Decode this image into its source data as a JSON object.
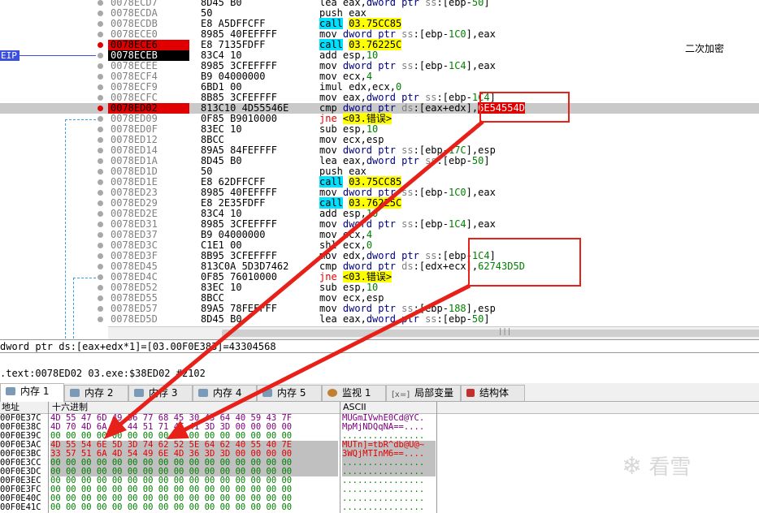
{
  "eip_label": "EIP",
  "comment_text": "二次加密",
  "disasm_rows": [
    {
      "addr": "0078ECD7",
      "bytes": "8D45 B0",
      "asm": [
        [
          "mnem",
          "lea "
        ],
        [
          "reg",
          "eax"
        ],
        [
          "t",
          ","
        ],
        [
          "k",
          "dword ptr "
        ],
        [
          "seg",
          "ss"
        ],
        [
          "t",
          ":["
        ],
        [
          "reg",
          "ebp"
        ],
        [
          "t",
          "-"
        ],
        [
          "num",
          "50"
        ],
        [
          "t",
          "]"
        ]
      ],
      "bp": "gray",
      "style": ""
    },
    {
      "addr": "0078ECDA",
      "bytes": "50",
      "asm": [
        [
          "mnem",
          "push "
        ],
        [
          "reg",
          "eax"
        ]
      ],
      "bp": "gray",
      "style": ""
    },
    {
      "addr": "0078ECDB",
      "bytes": "E8 A5DFFCFF",
      "asm": [
        [
          "cyan",
          "call"
        ],
        [
          "t",
          " "
        ],
        [
          "yel",
          "03.75CC85"
        ]
      ],
      "bp": "gray",
      "style": ""
    },
    {
      "addr": "0078ECE0",
      "bytes": "8985 40FEFFFF",
      "asm": [
        [
          "mnem",
          "mov "
        ],
        [
          "k",
          "dword ptr "
        ],
        [
          "seg",
          "ss"
        ],
        [
          "t",
          ":["
        ],
        [
          "reg",
          "ebp"
        ],
        [
          "t",
          "-"
        ],
        [
          "num",
          "1C0"
        ],
        [
          "t",
          "],"
        ],
        [
          "reg",
          "eax"
        ]
      ],
      "bp": "gray",
      "style": ""
    },
    {
      "addr": "0078ECE6",
      "bytes": "E8 7135FDFF",
      "asm": [
        [
          "cyan",
          "call"
        ],
        [
          "t",
          " "
        ],
        [
          "yel",
          "03.76225C"
        ]
      ],
      "bp": "red",
      "style": "redbg"
    },
    {
      "addr": "0078ECEB",
      "bytes": "83C4 10",
      "asm": [
        [
          "mnem",
          "add "
        ],
        [
          "reg",
          "esp"
        ],
        [
          "t",
          ","
        ],
        [
          "num",
          "10"
        ]
      ],
      "bp": "gray",
      "style": "blackbg"
    },
    {
      "addr": "0078ECEE",
      "bytes": "8985 3CFEFFFF",
      "asm": [
        [
          "mnem",
          "mov "
        ],
        [
          "k",
          "dword ptr "
        ],
        [
          "seg",
          "ss"
        ],
        [
          "t",
          ":["
        ],
        [
          "reg",
          "ebp"
        ],
        [
          "t",
          "-"
        ],
        [
          "num",
          "1C4"
        ],
        [
          "t",
          "],"
        ],
        [
          "reg",
          "eax"
        ]
      ],
      "bp": "gray",
      "style": ""
    },
    {
      "addr": "0078ECF4",
      "bytes": "B9 04000000",
      "asm": [
        [
          "mnem",
          "mov "
        ],
        [
          "reg",
          "ecx"
        ],
        [
          "t",
          ","
        ],
        [
          "num",
          "4"
        ]
      ],
      "bp": "gray",
      "style": ""
    },
    {
      "addr": "0078ECF9",
      "bytes": "6BD1 00",
      "asm": [
        [
          "mnem",
          "imul "
        ],
        [
          "reg",
          "edx"
        ],
        [
          "t",
          ","
        ],
        [
          "reg",
          "ecx"
        ],
        [
          "t",
          ","
        ],
        [
          "num",
          "0"
        ]
      ],
      "bp": "gray",
      "style": ""
    },
    {
      "addr": "0078ECFC",
      "bytes": "8B85 3CFEFFFF",
      "asm": [
        [
          "mnem",
          "mov "
        ],
        [
          "reg",
          "eax"
        ],
        [
          "t",
          ","
        ],
        [
          "k",
          "dword ptr "
        ],
        [
          "seg",
          "ss"
        ],
        [
          "t",
          ":["
        ],
        [
          "reg",
          "ebp"
        ],
        [
          "t",
          "-"
        ],
        [
          "num",
          "1C4"
        ],
        [
          "t",
          "]"
        ]
      ],
      "bp": "gray",
      "style": ""
    },
    {
      "addr": "0078ED02",
      "bytes": "813C10 4D55546E",
      "asm": [
        [
          "mnem",
          "cmp "
        ],
        [
          "k",
          "dword ptr "
        ],
        [
          "seg",
          "ds"
        ],
        [
          "t",
          ":["
        ],
        [
          "reg",
          "eax"
        ],
        [
          "t",
          "+"
        ],
        [
          "reg",
          "edx"
        ],
        [
          "t",
          "],"
        ],
        [
          "redbox",
          "6E54554D"
        ]
      ],
      "bp": "red",
      "style": "redbg",
      "sel": true
    },
    {
      "addr": "0078ED09",
      "bytes": "0F85 B9010000",
      "asm": [
        [
          "red",
          "jne"
        ],
        [
          "t",
          " "
        ],
        [
          "yel",
          "<03.错误>"
        ]
      ],
      "bp": "gray",
      "style": ""
    },
    {
      "addr": "0078ED0F",
      "bytes": "83EC 10",
      "asm": [
        [
          "mnem",
          "sub "
        ],
        [
          "reg",
          "esp"
        ],
        [
          "t",
          ","
        ],
        [
          "num",
          "10"
        ]
      ],
      "bp": "gray",
      "style": ""
    },
    {
      "addr": "0078ED12",
      "bytes": "8BCC",
      "asm": [
        [
          "mnem",
          "mov "
        ],
        [
          "reg",
          "ecx"
        ],
        [
          "t",
          ","
        ],
        [
          "reg",
          "esp"
        ]
      ],
      "bp": "gray",
      "style": ""
    },
    {
      "addr": "0078ED14",
      "bytes": "89A5 84FEFFFF",
      "asm": [
        [
          "mnem",
          "mov "
        ],
        [
          "k",
          "dword ptr "
        ],
        [
          "seg",
          "ss"
        ],
        [
          "t",
          ":["
        ],
        [
          "reg",
          "ebp"
        ],
        [
          "t",
          "-"
        ],
        [
          "num",
          "17C"
        ],
        [
          "t",
          "],"
        ],
        [
          "reg",
          "esp"
        ]
      ],
      "bp": "gray",
      "style": ""
    },
    {
      "addr": "0078ED1A",
      "bytes": "8D45 B0",
      "asm": [
        [
          "mnem",
          "lea "
        ],
        [
          "reg",
          "eax"
        ],
        [
          "t",
          ","
        ],
        [
          "k",
          "dword ptr "
        ],
        [
          "seg",
          "ss"
        ],
        [
          "t",
          ":["
        ],
        [
          "reg",
          "ebp"
        ],
        [
          "t",
          "-"
        ],
        [
          "num",
          "50"
        ],
        [
          "t",
          "]"
        ]
      ],
      "bp": "gray",
      "style": ""
    },
    {
      "addr": "0078ED1D",
      "bytes": "50",
      "asm": [
        [
          "mnem",
          "push "
        ],
        [
          "reg",
          "eax"
        ]
      ],
      "bp": "gray",
      "style": ""
    },
    {
      "addr": "0078ED1E",
      "bytes": "E8 62DFFCFF",
      "asm": [
        [
          "cyan",
          "call"
        ],
        [
          "t",
          " "
        ],
        [
          "yel",
          "03.75CC85"
        ]
      ],
      "bp": "gray",
      "style": ""
    },
    {
      "addr": "0078ED23",
      "bytes": "8985 40FEFFFF",
      "asm": [
        [
          "mnem",
          "mov "
        ],
        [
          "k",
          "dword ptr "
        ],
        [
          "seg",
          "ss"
        ],
        [
          "t",
          ":["
        ],
        [
          "reg",
          "ebp"
        ],
        [
          "t",
          "-"
        ],
        [
          "num",
          "1C0"
        ],
        [
          "t",
          "],"
        ],
        [
          "reg",
          "eax"
        ]
      ],
      "bp": "gray",
      "style": ""
    },
    {
      "addr": "0078ED29",
      "bytes": "E8 2E35FDFF",
      "asm": [
        [
          "cyan",
          "call"
        ],
        [
          "t",
          " "
        ],
        [
          "yel",
          "03.76225C"
        ]
      ],
      "bp": "gray",
      "style": ""
    },
    {
      "addr": "0078ED2E",
      "bytes": "83C4 10",
      "asm": [
        [
          "mnem",
          "add "
        ],
        [
          "reg",
          "esp"
        ],
        [
          "t",
          ","
        ],
        [
          "num",
          "10"
        ]
      ],
      "bp": "gray",
      "style": ""
    },
    {
      "addr": "0078ED31",
      "bytes": "8985 3CFEFFFF",
      "asm": [
        [
          "mnem",
          "mov "
        ],
        [
          "k",
          "dword ptr "
        ],
        [
          "seg",
          "ss"
        ],
        [
          "t",
          ":["
        ],
        [
          "reg",
          "ebp"
        ],
        [
          "t",
          "-"
        ],
        [
          "num",
          "1C4"
        ],
        [
          "t",
          "],"
        ],
        [
          "reg",
          "eax"
        ]
      ],
      "bp": "gray",
      "style": ""
    },
    {
      "addr": "0078ED37",
      "bytes": "B9 04000000",
      "asm": [
        [
          "mnem",
          "mov "
        ],
        [
          "reg",
          "ecx"
        ],
        [
          "t",
          ","
        ],
        [
          "num",
          "4"
        ]
      ],
      "bp": "gray",
      "style": ""
    },
    {
      "addr": "0078ED3C",
      "bytes": "C1E1 00",
      "asm": [
        [
          "mnem",
          "shl "
        ],
        [
          "reg",
          "ecx"
        ],
        [
          "t",
          ","
        ],
        [
          "num",
          "0"
        ]
      ],
      "bp": "gray",
      "style": ""
    },
    {
      "addr": "0078ED3F",
      "bytes": "8B95 3CFEFFFF",
      "asm": [
        [
          "mnem",
          "mov "
        ],
        [
          "reg",
          "edx"
        ],
        [
          "t",
          ","
        ],
        [
          "k",
          "dword ptr "
        ],
        [
          "seg",
          "ss"
        ],
        [
          "t",
          ":["
        ],
        [
          "reg",
          "ebp"
        ],
        [
          "t",
          "-"
        ],
        [
          "num",
          "1C4"
        ],
        [
          "t",
          "]"
        ]
      ],
      "bp": "gray",
      "style": ""
    },
    {
      "addr": "0078ED45",
      "bytes": "813C0A 5D3D7462",
      "asm": [
        [
          "mnem",
          "cmp "
        ],
        [
          "k",
          "dword ptr "
        ],
        [
          "seg",
          "ds"
        ],
        [
          "t",
          ":["
        ],
        [
          "reg",
          "edx"
        ],
        [
          "t",
          "+"
        ],
        [
          "reg",
          "ecx"
        ],
        [
          "t",
          "],"
        ],
        [
          "num",
          "62743D5D"
        ]
      ],
      "bp": "gray",
      "style": ""
    },
    {
      "addr": "0078ED4C",
      "bytes": "0F85 76010000",
      "asm": [
        [
          "red",
          "jne"
        ],
        [
          "t",
          " "
        ],
        [
          "yel",
          "<03.错误>"
        ]
      ],
      "bp": "gray",
      "style": ""
    },
    {
      "addr": "0078ED52",
      "bytes": "83EC 10",
      "asm": [
        [
          "mnem",
          "sub "
        ],
        [
          "reg",
          "esp"
        ],
        [
          "t",
          ","
        ],
        [
          "num",
          "10"
        ]
      ],
      "bp": "gray",
      "style": ""
    },
    {
      "addr": "0078ED55",
      "bytes": "8BCC",
      "asm": [
        [
          "mnem",
          "mov "
        ],
        [
          "reg",
          "ecx"
        ],
        [
          "t",
          ","
        ],
        [
          "reg",
          "esp"
        ]
      ],
      "bp": "gray",
      "style": ""
    },
    {
      "addr": "0078ED57",
      "bytes": "89A5 78FEFFFF",
      "asm": [
        [
          "mnem",
          "mov "
        ],
        [
          "k",
          "dword ptr "
        ],
        [
          "seg",
          "ss"
        ],
        [
          "t",
          ":["
        ],
        [
          "reg",
          "ebp"
        ],
        [
          "t",
          "-"
        ],
        [
          "num",
          "188"
        ],
        [
          "t",
          "],"
        ],
        [
          "reg",
          "esp"
        ]
      ],
      "bp": "gray",
      "style": ""
    },
    {
      "addr": "0078ED5D",
      "bytes": "8D45 B0",
      "asm": [
        [
          "mnem",
          "lea "
        ],
        [
          "reg",
          "eax"
        ],
        [
          "t",
          ","
        ],
        [
          "k",
          "dword ptr "
        ],
        [
          "seg",
          "ss"
        ],
        [
          "t",
          ":["
        ],
        [
          "reg",
          "ebp"
        ],
        [
          "t",
          "-"
        ],
        [
          "num",
          "50"
        ],
        [
          "t",
          "]"
        ]
      ],
      "bp": "gray",
      "style": ""
    }
  ],
  "info_line": "dword ptr ds:[eax+edx*1]=[03.00F0E383]=43304568",
  "status_line": ".text:0078ED02 03.exe:$38ED02 #2102",
  "tabs": [
    "内存 1",
    "内存 2",
    "内存 3",
    "内存 4",
    "内存 5",
    "监视 1",
    "局部变量",
    "结构体"
  ],
  "mem_header": {
    "addr": "地址",
    "hex": "十六进制",
    "ascii": "ASCII"
  },
  "mem_rows": [
    {
      "addr": "00F0E37C",
      "hex": "4D 55 47 6D 49 56 77 68 45 30 43 64 40 59 43 7F",
      "ascii": "MUGmIVwhE0Cd@YC.",
      "style": "purple"
    },
    {
      "addr": "00F0E38C",
      "hex": "4D 70 4D 6A 4E 44 51 71 4E 41 3D 3D 00 00 00 00",
      "ascii": "MpMjNDQqNA==....",
      "style": "purple"
    },
    {
      "addr": "00F0E39C",
      "hex": "00 00 00 00 00 00 00 00 00 00 00 00 00 00 00 00",
      "ascii": "................",
      "style": ""
    },
    {
      "addr": "00F0E3AC",
      "hex": "4D 55 54 6E 5D 3D 74 62 52 5E 64 62 40 55 40 7E",
      "ascii": "MUTn]=tbR^db@U@~",
      "style": "hl"
    },
    {
      "addr": "00F0E3BC",
      "hex": "33 57 51 6A 4D 54 49 6E 4D 36 3D 3D 00 00 00 00",
      "ascii": "3WQjMTInM6==....",
      "style": "hl"
    },
    {
      "addr": "00F0E3CC",
      "hex": "00 00 00 00 00 00 00 00 00 00 00 00 00 00 00 00",
      "ascii": "................",
      "style": "hlg"
    },
    {
      "addr": "00F0E3DC",
      "hex": "00 00 00 00 00 00 00 00 00 00 00 00 00 00 00 00",
      "ascii": "................",
      "style": "hlg"
    },
    {
      "addr": "00F0E3EC",
      "hex": "00 00 00 00 00 00 00 00 00 00 00 00 00 00 00 00",
      "ascii": "................",
      "style": ""
    },
    {
      "addr": "00F0E3FC",
      "hex": "00 00 00 00 00 00 00 00 00 00 00 00 00 00 00 00",
      "ascii": "................",
      "style": ""
    },
    {
      "addr": "00F0E40C",
      "hex": "00 00 00 00 00 00 00 00 00 00 00 00 00 00 00 00",
      "ascii": "................",
      "style": ""
    },
    {
      "addr": "00F0E41C",
      "hex": "00 00 00 00 00 00 00 00 00 00 00 00 00 00 00 00",
      "ascii": "................",
      "style": ""
    }
  ],
  "watermark_text": "看雪",
  "colors": {
    "accent_red": "#e8201a",
    "breakpoint_red": "#e00000",
    "eip_blue": "#3c50e0",
    "call_cyan": "#00e0ff",
    "jump_yellow": "#ffff00"
  }
}
